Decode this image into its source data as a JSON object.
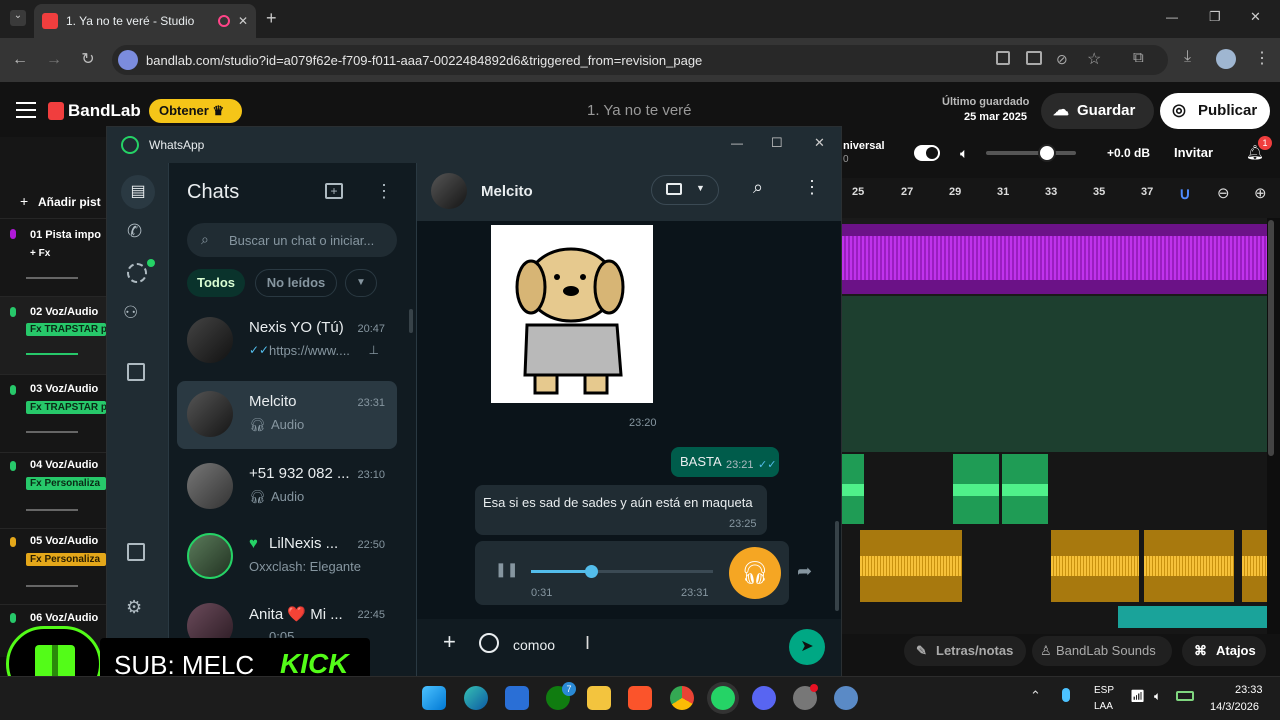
{
  "browser": {
    "tab_title": "1. Ya no te veré - Studio",
    "url": "bandlab.com/studio?id=a079f62e-f709-f011-aaa7-0022484892d6&triggered_from=revision_page",
    "window_min": "—",
    "window_max": "❐",
    "window_close": "✕",
    "new_tab": "+"
  },
  "bandlab": {
    "logo": "BandLab",
    "obtener": "Obtener",
    "project_title": "1. Ya no te veré",
    "last_saved_label": "Último guardado",
    "last_saved_date": "25 mar 2025",
    "save_label": "Guardar",
    "publish_label": "Publicar",
    "invite_label": "Invitar",
    "notif_count": "1",
    "universal_label": "niversal",
    "universal_sub": "0",
    "db_value": "+0.0 dB",
    "add_track": "Añadir pist",
    "ruler": [
      "25",
      "27",
      "29",
      "31",
      "33",
      "35",
      "37"
    ],
    "tracks": [
      {
        "name": "01  Pista impo",
        "fx": "+ Fx"
      },
      {
        "name": "02  Voz/Audio",
        "fx": "Fx TRAPSTAR p"
      },
      {
        "name": "03  Voz/Audio",
        "fx": "Fx TRAPSTAR p"
      },
      {
        "name": "04  Voz/Audio",
        "fx": "Fx Personaliza"
      },
      {
        "name": "05  Voz/Audio",
        "fx": "Fx Personaliza"
      },
      {
        "name": "06  Voz/Audio",
        "fx": ""
      }
    ],
    "bottom_tabs": {
      "lyrics": "Letras/notas",
      "sounds": "BandLab Sounds",
      "shortcuts": "Atajos"
    }
  },
  "whatsapp": {
    "app_name": "WhatsApp",
    "window_min": "—",
    "window_max": "☐",
    "window_close": "✕",
    "list_title": "Chats",
    "search_placeholder": "Buscar un chat o iniciar...",
    "filters": [
      "Todos",
      "No leídos"
    ],
    "chats": [
      {
        "name": "Nexis YO (Tú)",
        "time": "20:47",
        "preview": "https://www...."
      },
      {
        "name": "Melcito",
        "time": "23:31",
        "preview": "Audio"
      },
      {
        "name": "+51 932 082 ...",
        "time": "23:10",
        "preview": "Audio"
      },
      {
        "name": "LilNexis ...",
        "time": "22:50",
        "preview": "Oxxclash: Elegante"
      },
      {
        "name": "Anita ❤️ Mi ...",
        "time": "22:45",
        "preview": "0:05"
      }
    ],
    "active_chat": {
      "name": "Melcito",
      "sticker_time": "23:20",
      "outgoing_text": "BASTA",
      "outgoing_time": "23:21",
      "incoming_text": "Esa si es sad de sades y aún está en maqueta",
      "incoming_time": "23:25",
      "voice": {
        "elapsed": "0:31",
        "time": "23:31",
        "progress": 0.33
      },
      "composer_text": "comoo"
    }
  },
  "overlay": {
    "sub_text": "SUB: MELC",
    "kick_text": "KICK"
  },
  "taskbar": {
    "lang": "ESP",
    "lang_sub": "LAA",
    "clock_time": "23:33",
    "clock_date": "14/3/2026",
    "xbox_badge": "7"
  },
  "colors": {
    "wa_green": "#00a884",
    "outgoing_bubble": "#005c4b",
    "incoming_bubble": "#202c33",
    "bandlab_red": "#f03e3e",
    "purple_track": "#b019d8",
    "green_track": "#1f6b4a",
    "yellow_track": "#e4a71a",
    "teal_track": "#1aa39a"
  }
}
